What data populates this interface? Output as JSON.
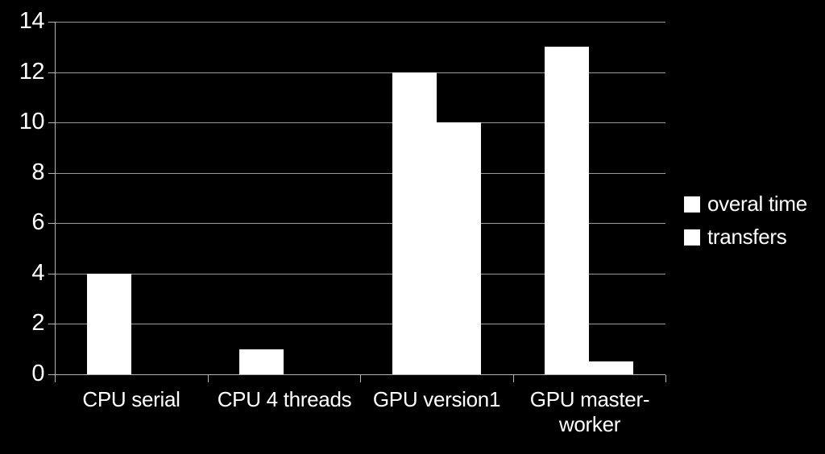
{
  "chart_data": {
    "type": "bar",
    "title": "",
    "subtitle": "",
    "xlabel": "",
    "ylabel": "",
    "categories": [
      "CPU serial",
      "CPU 4 threads",
      "GPU version1",
      "GPU master-worker"
    ],
    "series": [
      {
        "name": "overal time",
        "values": [
          4,
          1,
          12,
          13
        ]
      },
      {
        "name": "transfers",
        "values": [
          0,
          0,
          10,
          0.5
        ]
      }
    ],
    "ylim": [
      0,
      14
    ],
    "ytick_values": [
      0,
      2,
      4,
      6,
      8,
      10,
      12,
      14
    ],
    "ytick_labels": [
      "0",
      "2",
      "4",
      "6",
      "8",
      "10",
      "12",
      "14"
    ],
    "grid": true,
    "grid_axis": "y",
    "legend_position": "right",
    "legend_marker": "square",
    "background_color": "#000000",
    "bar_color": "#ffffff",
    "gridline_color": "#9a9a9a",
    "axis_color": "#b4b4b4",
    "text_color": "#ffffff"
  },
  "axis": {
    "y_ticks": [
      {
        "label": "14",
        "value": 14
      },
      {
        "label": "12",
        "value": 12
      },
      {
        "label": "10",
        "value": 10
      },
      {
        "label": "8",
        "value": 8
      },
      {
        "label": "6",
        "value": 6
      },
      {
        "label": "4",
        "value": 4
      },
      {
        "label": "2",
        "value": 2
      },
      {
        "label": "0",
        "value": 0
      }
    ]
  },
  "legend": {
    "items": [
      {
        "label": "overal time",
        "color": "#ffffff"
      },
      {
        "label": "transfers",
        "color": "#ffffff"
      }
    ]
  },
  "categories": [
    {
      "label": "CPU serial",
      "lines": [
        "CPU serial"
      ]
    },
    {
      "label": "CPU 4 threads",
      "lines": [
        "CPU 4 threads"
      ]
    },
    {
      "label": "GPU version1",
      "lines": [
        "GPU version1"
      ]
    },
    {
      "label": "GPU master-worker",
      "lines": [
        "GPU master-",
        "worker"
      ]
    }
  ]
}
